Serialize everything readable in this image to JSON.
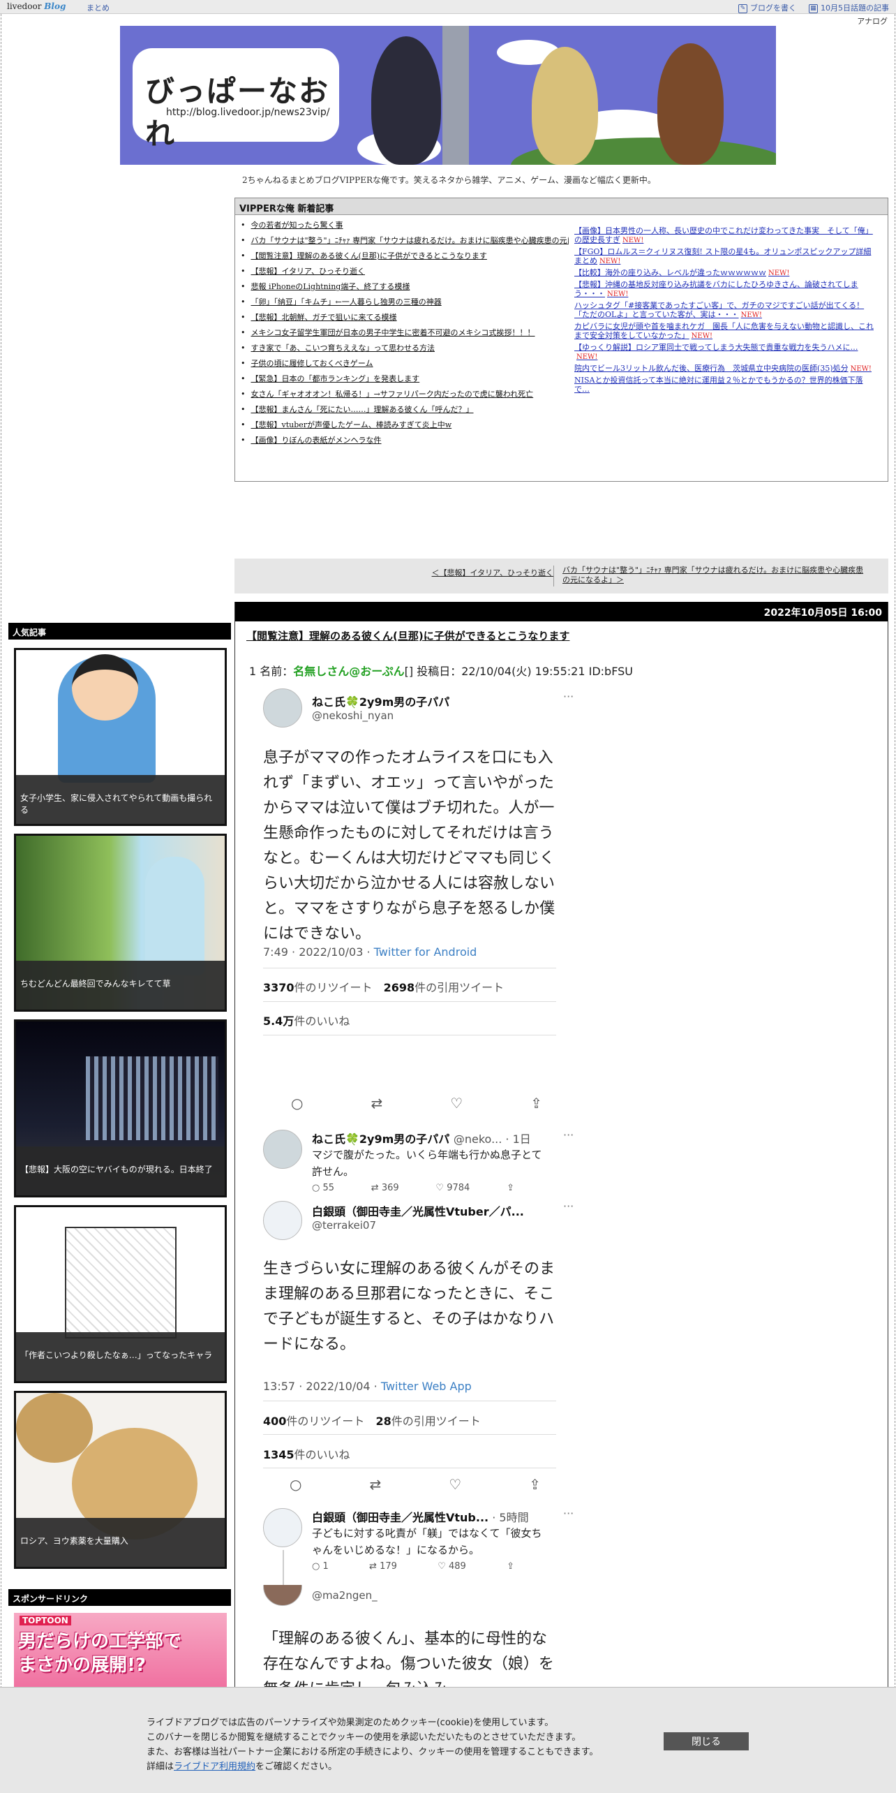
{
  "topbar": {
    "logo_text": "livedoor",
    "logo_blog": "Blog",
    "matome": "まとめ",
    "write_blog": "ブログを書く",
    "today_topics": "10月5日話題の記事",
    "analog": "アナログ"
  },
  "banner": {
    "title": "びっぱーなおれ",
    "url": "http://blog.livedoor.jp/news23vip/"
  },
  "tagline": "2ちゃんねるまとめブログVIPPERな俺です。笑えるネタから雑学、アニメ、ゲーム、漫画など幅広く更新中。",
  "new_posts": {
    "heading": "VIPPERな俺 新着記事",
    "left": [
      "今の若者が知ったら驚く事",
      "バカ「サウナは\"整う\"」ﾆﾁｬｧ 専門家「サウナは疲れるだけ。おまけに脳疾患や心臓疾患の元になるよ」",
      "【閲覧注意】理解のある彼くん(旦那)に子供ができるとこうなります",
      "【悲報】イタリア、ひっそり逝く",
      "悲報 iPhoneのLightning端子、終了する模様",
      "「卵」「納豆」「キムチ」←一人暮らし独男の三種の神器",
      "【悲報】北朝鮮、ガチで狙いに来てる模様",
      "メキシコ女子留学生軍団が日本の男子中学生に密着不可避のメキシコ式挨拶！！！",
      "すき家で「あ、こいつ育ちええな」って思わせる方法",
      "子供の頃に履修しておくべきゲーム",
      "【緊急】日本の「都市ランキング」を発表します",
      "女さん「ギャオオオン！私帰る！」→サファリパーク内だったので虎に襲われ死亡",
      "【悲報】まんさん「死にたい……」理解ある彼くん「呼んだ？」",
      "【悲報】vtuberが声優したゲーム、棒読みすぎて炎上中w",
      "【画像】りぼんの表紙がメンヘラな件"
    ],
    "right": [
      {
        "text": "【画像】日本男性の一人称、長い歴史の中でこれだけ変わってきた事実　そして「俺」の歴史長すぎ",
        "new": "NEW!"
      },
      {
        "text": "【FGO】ロムルス＝クィリヌス復刻! スト限の星4も。オリュンポスピックアップ詳細まとめ",
        "new": "NEW!"
      },
      {
        "text": "【比較】海外の座り込み、レベルが違ったｗｗｗｗｗｗ",
        "new": "NEW!"
      },
      {
        "text": "【悲報】沖縄の基地反対座り込み抗議をバカにしたひろゆきさん、論破されてしまう・・・",
        "new": "NEW!"
      },
      {
        "text": "ハッシュタグ「#接客業であったすごい客」で、ガチのマジですごい話が出てくる！「ただのOLよ」と言っていた客が、実は・・・",
        "new": "NEW!"
      },
      {
        "text": "カピバラに女児が頭や首を噛まれケガ　園長「人に危害を与えない動物と認識し、これまで安全対策をしていなかった」",
        "new": "NEW!"
      },
      {
        "text": "【ゆっくり解説】ロシア軍同士で戦ってしまう大失態で貴重な戦力を失うハメに…",
        "new": "NEW!"
      },
      {
        "text": "院内でビール3リットル飲んだ後、医療行為　茨城県立中央病院の医師(35)処分",
        "new": "NEW!"
      },
      {
        "text": "NISAとか投資信託って本当に絶対に運用益２％とかでもうかるの？世界的株価下落で…",
        "new": ""
      }
    ]
  },
  "nav": {
    "prev": "＜【悲報】イタリア、ひっそり逝く",
    "next": "バカ「サウナは\"整う\"」ﾆﾁｬｧ 専門家「サウナは疲れるだけ。おまけに脳疾患や心臓疾患の元になるよ」＞"
  },
  "sidebar": {
    "popular_heading": "人気記事",
    "popular": [
      "女子小学生、家に侵入されてやられて動画も撮られる",
      "ちむどんどん最終回でみんなキレてて草",
      "【悲報】大阪の空にヤバイものが現れる。日本終了",
      "「作者こいつより殺したなぁ…」ってなったキャラ",
      "ロシア、ヨウ素薬を大量購入"
    ],
    "sponsor_heading": "スポンサードリンク",
    "ad_brand": "TOPTOON",
    "ad_copy_1": "男だらけの工学部で",
    "ad_copy_2": "まさかの展開!?"
  },
  "article": {
    "date": "2022年10月05日 16:00",
    "title": "【閲覧注意】理解のある彼くん(旦那)に子供ができるとこうなります",
    "res_num": "1",
    "res_label": "名前：",
    "res_name": "名無しさん@おーぷん",
    "res_meta": "[] 投稿日：22/10/04(火) 19:55:21 ID:bFSU"
  },
  "tweet1": {
    "name": "ねこ氏🍀2y9m男の子パパ",
    "handle": "@nekoshi_nyan",
    "text": "息子がママの作ったオムライスを口にも入れず「まずい、オエッ」って言いやがったからママは泣いて僕はブチ切れた。人が一生懸命作ったものに対してそれだけは言うなと。むーくんは大切だけどママも同じくらい大切だから泣かせる人には容赦しないと。ママをさすりながら息子を怒るしか僕にはできない。",
    "time": "7:49 · 2022/10/03 · ",
    "source": "Twitter for Android",
    "retweets": "3370",
    "retweets_label": "件のリツイート",
    "quotes": "2698",
    "quotes_label": "件の引用ツイート",
    "likes": "5.4万",
    "likes_label": "件のいいね"
  },
  "reply1": {
    "name": "ねこ氏🍀2y9m男の子パパ",
    "handle": "@neko... · 1日",
    "text": "マジで腹がたった。いくら年端も行かぬ息子とて許せん。",
    "replies": "55",
    "retweets": "369",
    "likes": "9784"
  },
  "tweet2": {
    "name": "白銀頭（御田寺圭／光属性Vtuber／パ...",
    "handle": "@terrakei07",
    "text": "生きづらい女に理解のある彼くんがそのまま理解のある旦那君になったときに、そこで子どもが誕生すると、その子はかなりハードになる。",
    "time": "13:57 · 2022/10/04 · ",
    "source": "Twitter Web App",
    "retweets": "400",
    "retweets_label": "件のリツイート",
    "quotes": "28",
    "quotes_label": "件の引用ツイート",
    "likes": "1345",
    "likes_label": "件のいいね"
  },
  "reply2": {
    "name": "白銀頭（御田寺圭／光属性Vtub...",
    "handle": " · 5時間",
    "text": "子どもに対する叱責が「躾」ではなくて「彼女ちゃんをいじめるな！」になるから。",
    "replies": "1",
    "retweets": "179",
    "likes": "489"
  },
  "tweet3": {
    "handle": "@ma2ngen_",
    "text": "「理解のある彼くん」、基本的に母性的な存在なんですよね。傷ついた彼女（娘）を無条件に肯定し、包み込み"
  },
  "cookie": {
    "line1": "ライブドアブログでは広告のパーソナライズや効果測定のためクッキー(cookie)を使用しています。",
    "line2": "このバナーを閉じるか閲覧を継続することでクッキーの使用を承認いただいたものとさせていただきます。",
    "line3": "また、お客様は当社パートナー企業における所定の手続きにより、クッキーの使用を管理することもできます。",
    "line4_pre": "詳細は",
    "line4_link": "ライブドア利用規約",
    "line4_post": "をご確認ください。",
    "close": "閉じる"
  }
}
